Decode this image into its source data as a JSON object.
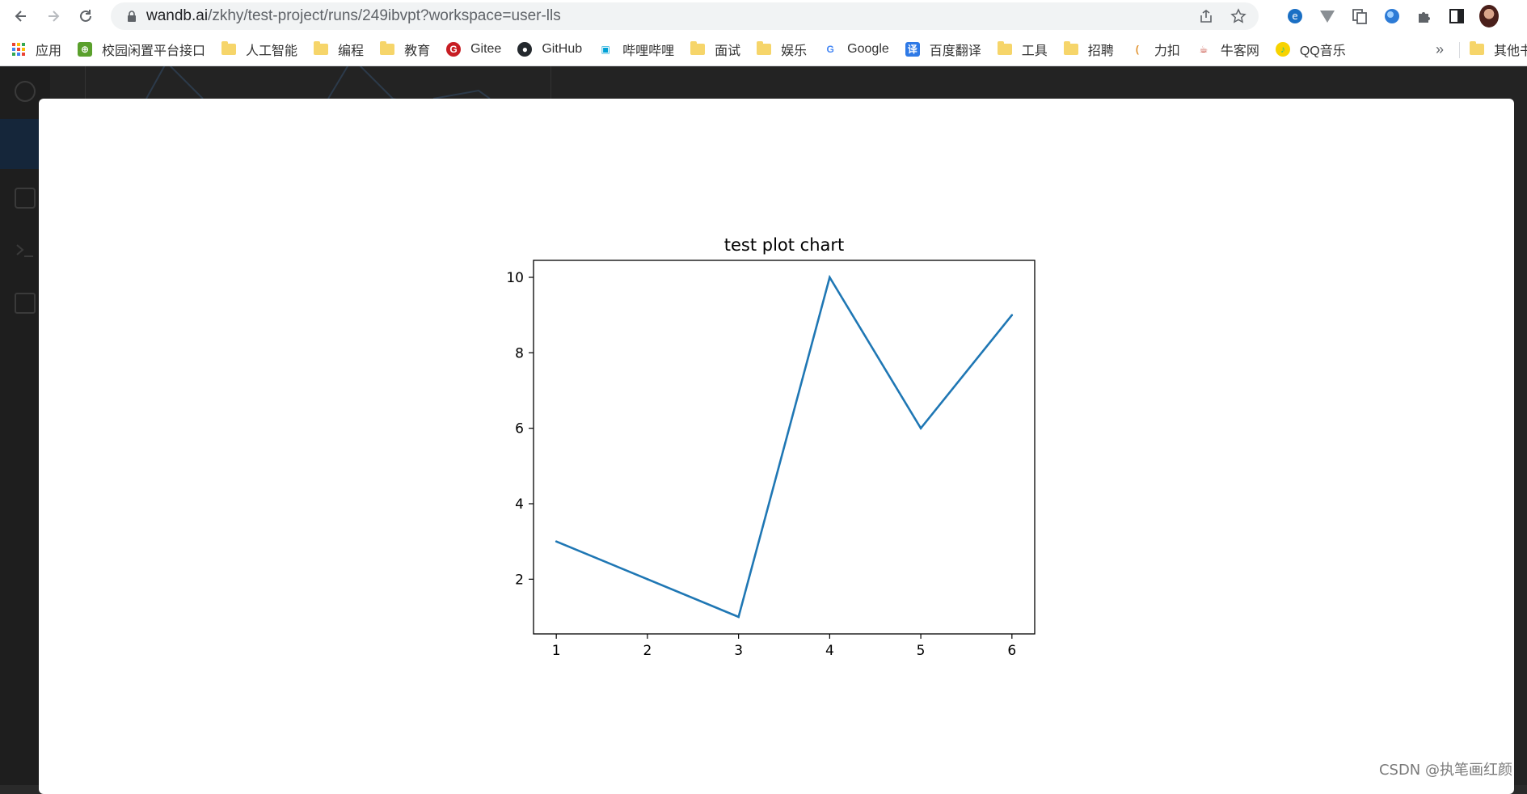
{
  "browser": {
    "url_host": "wandb.ai",
    "url_path": "/zkhy/test-project/runs/249ibvpt?workspace=user-lls",
    "bookmarks": [
      {
        "label": "应用",
        "icon": "apps-grid-icon"
      },
      {
        "label": "校园闲置平台接口",
        "icon": "site-icon"
      },
      {
        "label": "人工智能",
        "icon": "folder-icon"
      },
      {
        "label": "编程",
        "icon": "folder-icon"
      },
      {
        "label": "教育",
        "icon": "folder-icon"
      },
      {
        "label": "Gitee",
        "icon": "gitee-icon"
      },
      {
        "label": "GitHub",
        "icon": "github-icon"
      },
      {
        "label": "哔哩哔哩",
        "icon": "bilibili-icon"
      },
      {
        "label": "面试",
        "icon": "folder-icon"
      },
      {
        "label": "娱乐",
        "icon": "folder-icon"
      },
      {
        "label": "Google",
        "icon": "google-icon"
      },
      {
        "label": "百度翻译",
        "icon": "translate-icon"
      },
      {
        "label": "工具",
        "icon": "folder-icon"
      },
      {
        "label": "招聘",
        "icon": "folder-icon"
      },
      {
        "label": "力扣",
        "icon": "leetcode-icon"
      },
      {
        "label": "牛客网",
        "icon": "nowcoder-icon"
      },
      {
        "label": "QQ音乐",
        "icon": "qqmusic-icon"
      }
    ],
    "more_label": "»",
    "other_bookmarks": "其他书"
  },
  "chart_data": {
    "type": "line",
    "title": "test plot chart",
    "xlabel": "",
    "ylabel": "",
    "x": [
      1,
      2,
      3,
      4,
      5,
      6
    ],
    "y": [
      3,
      2,
      1,
      10,
      6,
      9
    ],
    "xticks": [
      1,
      2,
      3,
      4,
      5,
      6
    ],
    "yticks": [
      2,
      4,
      6,
      8,
      10
    ],
    "xlim": [
      0.75,
      6.25
    ],
    "ylim": [
      0.55,
      10.45
    ],
    "grid": false,
    "line_color": "#1f77b4"
  },
  "watermark": "CSDN @执笔画红颜"
}
